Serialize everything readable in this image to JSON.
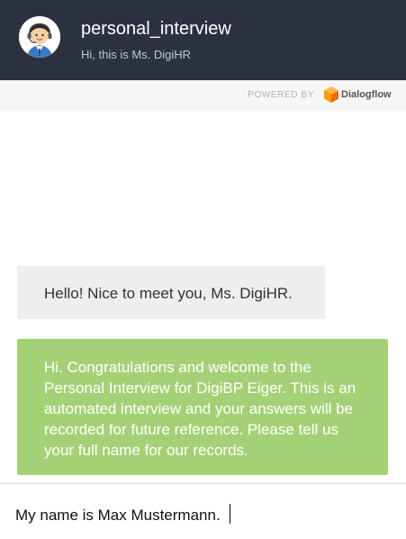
{
  "header": {
    "title": "personal_interview",
    "subtitle": "Hi, this is Ms. DigiHR"
  },
  "powered_by": {
    "label": "POWERED BY",
    "brand": "Dialogflow"
  },
  "messages": [
    {
      "sender": "user",
      "text": "Hello! Nice to meet you, Ms. DigiHR."
    },
    {
      "sender": "agent",
      "text": "Hi. Congratulations and welcome to the Personal Interview for DigiBP Eiger. This is an automated interview and your answers will be recorded for future reference. Please tell us your full name for our records."
    }
  ],
  "input": {
    "value": "My name is Max Mustermann."
  },
  "colors": {
    "header_bg": "#2c3140",
    "agent_bubble": "#a5d176",
    "user_bubble": "#eeeeee",
    "dialogflow_orange": "#ff9800"
  },
  "icons": {
    "avatar": "agent-avatar-icon",
    "brand": "dialogflow-logo-icon"
  }
}
